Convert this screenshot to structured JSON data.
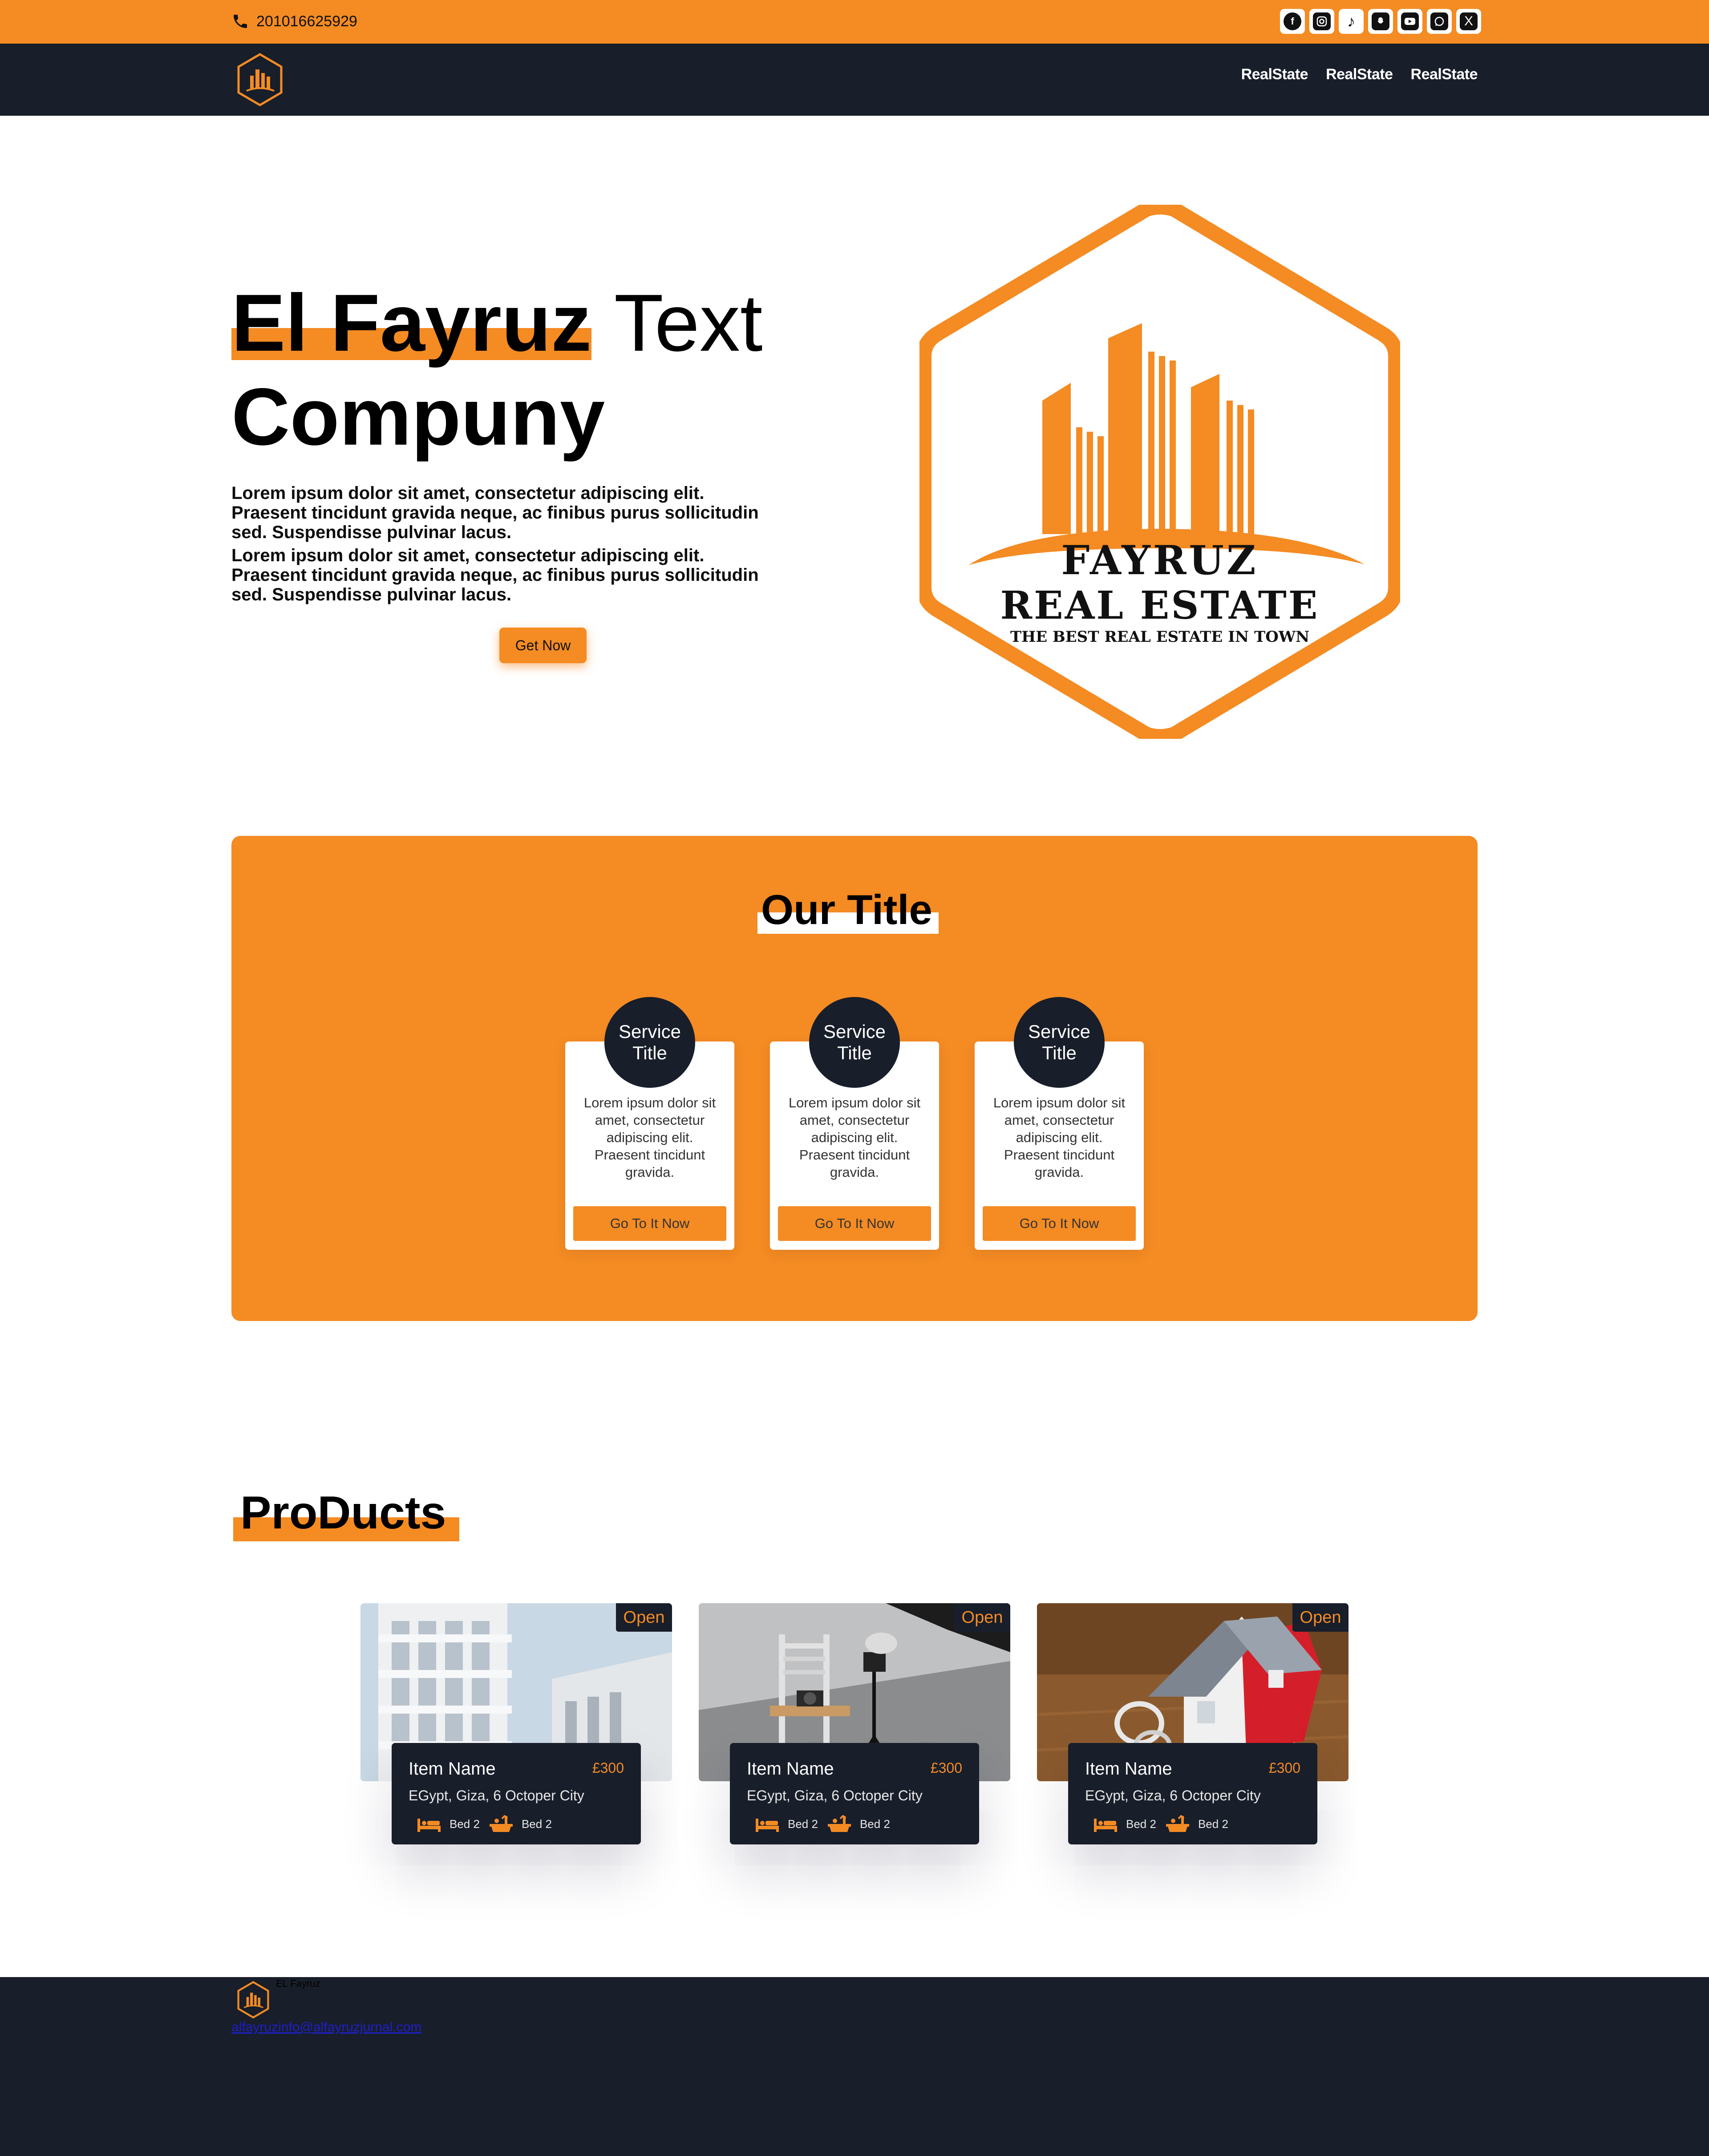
{
  "topbar": {
    "phone": "201016625929",
    "socials": [
      "facebook-icon",
      "instagram-icon",
      "tiktok-icon",
      "snapchat-icon",
      "youtube-icon",
      "whatsapp-icon",
      "x-icon"
    ]
  },
  "nav": {
    "links": [
      "RealState",
      "RealState",
      "RealState"
    ]
  },
  "hero": {
    "title_highlight": "El Fayruz",
    "title_rest": "Text",
    "title_line2": "Compuny",
    "paragraphs": [
      "Lorem ipsum dolor sit amet, consectetur adipiscing elit. Praesent tincidunt gravida neque, ac finibus purus sollicitudin sed. Suspendisse pulvinar lacus.",
      "Lorem ipsum dolor sit amet, consectetur adipiscing elit. Praesent tincidunt gravida neque, ac finibus purus sollicitudin sed. Suspendisse pulvinar lacus."
    ],
    "cta": "Get Now",
    "logo": {
      "line1": "FAYRUZ",
      "line2": "REAL ESTATE",
      "tagline": "THE BEST REAL ESTATE IN TOWN"
    }
  },
  "services": {
    "title": "Our Title",
    "items": [
      {
        "title": "Service Title",
        "text": "Lorem ipsum dolor sit amet, consectetur adipiscing elit. Praesent tincidunt gravida.",
        "button": "Go To It Now"
      },
      {
        "title": "Service Title",
        "text": "Lorem ipsum dolor sit amet, consectetur adipiscing elit. Praesent tincidunt gravida.",
        "button": "Go To It Now"
      },
      {
        "title": "Service Title",
        "text": "Lorem ipsum dolor sit amet, consectetur adipiscing elit. Praesent tincidunt gravida.",
        "button": "Go To It Now"
      }
    ]
  },
  "products": {
    "title": "ProDucts",
    "items": [
      {
        "badge": "Open",
        "name": "Item Name",
        "price": "£300",
        "location": "EGypt, Giza, 6 Octoper City",
        "feat1": "Bed 2",
        "feat2": "Bed 2"
      },
      {
        "badge": "Open",
        "name": "Item Name",
        "price": "£300",
        "location": "EGypt, Giza, 6 Octoper City",
        "feat1": "Bed 2",
        "feat2": "Bed 2"
      },
      {
        "badge": "Open",
        "name": "Item Name",
        "price": "£300",
        "location": "EGypt, Giza, 6 Octoper City",
        "feat1": "Bed 2",
        "feat2": "Bed 2"
      }
    ]
  },
  "footer": {
    "name": "EL Fayruz",
    "email": "alfayruzinfo@alfayruzjurnal.com"
  },
  "colors": {
    "accent": "#f48b23",
    "dark": "#181e2a",
    "white": "#ffffff"
  }
}
